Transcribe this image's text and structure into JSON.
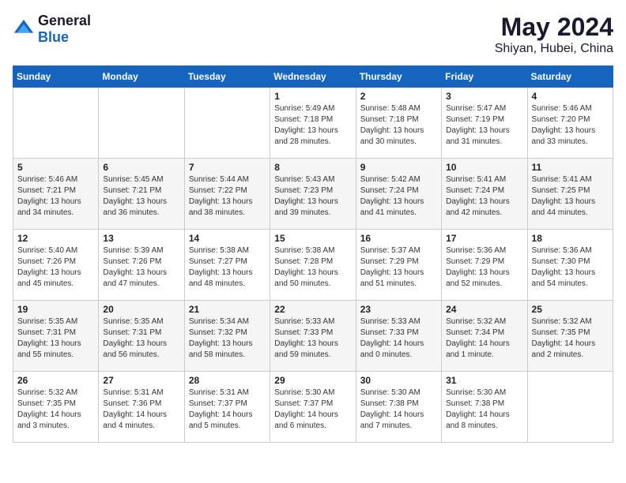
{
  "header": {
    "logo_general": "General",
    "logo_blue": "Blue",
    "month_title": "May 2024",
    "location": "Shiyan, Hubei, China"
  },
  "days_of_week": [
    "Sunday",
    "Monday",
    "Tuesday",
    "Wednesday",
    "Thursday",
    "Friday",
    "Saturday"
  ],
  "weeks": [
    [
      {
        "day": "",
        "info": ""
      },
      {
        "day": "",
        "info": ""
      },
      {
        "day": "",
        "info": ""
      },
      {
        "day": "1",
        "info": "Sunrise: 5:49 AM\nSunset: 7:18 PM\nDaylight: 13 hours\nand 28 minutes."
      },
      {
        "day": "2",
        "info": "Sunrise: 5:48 AM\nSunset: 7:18 PM\nDaylight: 13 hours\nand 30 minutes."
      },
      {
        "day": "3",
        "info": "Sunrise: 5:47 AM\nSunset: 7:19 PM\nDaylight: 13 hours\nand 31 minutes."
      },
      {
        "day": "4",
        "info": "Sunrise: 5:46 AM\nSunset: 7:20 PM\nDaylight: 13 hours\nand 33 minutes."
      }
    ],
    [
      {
        "day": "5",
        "info": "Sunrise: 5:46 AM\nSunset: 7:21 PM\nDaylight: 13 hours\nand 34 minutes."
      },
      {
        "day": "6",
        "info": "Sunrise: 5:45 AM\nSunset: 7:21 PM\nDaylight: 13 hours\nand 36 minutes."
      },
      {
        "day": "7",
        "info": "Sunrise: 5:44 AM\nSunset: 7:22 PM\nDaylight: 13 hours\nand 38 minutes."
      },
      {
        "day": "8",
        "info": "Sunrise: 5:43 AM\nSunset: 7:23 PM\nDaylight: 13 hours\nand 39 minutes."
      },
      {
        "day": "9",
        "info": "Sunrise: 5:42 AM\nSunset: 7:24 PM\nDaylight: 13 hours\nand 41 minutes."
      },
      {
        "day": "10",
        "info": "Sunrise: 5:41 AM\nSunset: 7:24 PM\nDaylight: 13 hours\nand 42 minutes."
      },
      {
        "day": "11",
        "info": "Sunrise: 5:41 AM\nSunset: 7:25 PM\nDaylight: 13 hours\nand 44 minutes."
      }
    ],
    [
      {
        "day": "12",
        "info": "Sunrise: 5:40 AM\nSunset: 7:26 PM\nDaylight: 13 hours\nand 45 minutes."
      },
      {
        "day": "13",
        "info": "Sunrise: 5:39 AM\nSunset: 7:26 PM\nDaylight: 13 hours\nand 47 minutes."
      },
      {
        "day": "14",
        "info": "Sunrise: 5:38 AM\nSunset: 7:27 PM\nDaylight: 13 hours\nand 48 minutes."
      },
      {
        "day": "15",
        "info": "Sunrise: 5:38 AM\nSunset: 7:28 PM\nDaylight: 13 hours\nand 50 minutes."
      },
      {
        "day": "16",
        "info": "Sunrise: 5:37 AM\nSunset: 7:29 PM\nDaylight: 13 hours\nand 51 minutes."
      },
      {
        "day": "17",
        "info": "Sunrise: 5:36 AM\nSunset: 7:29 PM\nDaylight: 13 hours\nand 52 minutes."
      },
      {
        "day": "18",
        "info": "Sunrise: 5:36 AM\nSunset: 7:30 PM\nDaylight: 13 hours\nand 54 minutes."
      }
    ],
    [
      {
        "day": "19",
        "info": "Sunrise: 5:35 AM\nSunset: 7:31 PM\nDaylight: 13 hours\nand 55 minutes."
      },
      {
        "day": "20",
        "info": "Sunrise: 5:35 AM\nSunset: 7:31 PM\nDaylight: 13 hours\nand 56 minutes."
      },
      {
        "day": "21",
        "info": "Sunrise: 5:34 AM\nSunset: 7:32 PM\nDaylight: 13 hours\nand 58 minutes."
      },
      {
        "day": "22",
        "info": "Sunrise: 5:33 AM\nSunset: 7:33 PM\nDaylight: 13 hours\nand 59 minutes."
      },
      {
        "day": "23",
        "info": "Sunrise: 5:33 AM\nSunset: 7:33 PM\nDaylight: 14 hours\nand 0 minutes."
      },
      {
        "day": "24",
        "info": "Sunrise: 5:32 AM\nSunset: 7:34 PM\nDaylight: 14 hours\nand 1 minute."
      },
      {
        "day": "25",
        "info": "Sunrise: 5:32 AM\nSunset: 7:35 PM\nDaylight: 14 hours\nand 2 minutes."
      }
    ],
    [
      {
        "day": "26",
        "info": "Sunrise: 5:32 AM\nSunset: 7:35 PM\nDaylight: 14 hours\nand 3 minutes."
      },
      {
        "day": "27",
        "info": "Sunrise: 5:31 AM\nSunset: 7:36 PM\nDaylight: 14 hours\nand 4 minutes."
      },
      {
        "day": "28",
        "info": "Sunrise: 5:31 AM\nSunset: 7:37 PM\nDaylight: 14 hours\nand 5 minutes."
      },
      {
        "day": "29",
        "info": "Sunrise: 5:30 AM\nSunset: 7:37 PM\nDaylight: 14 hours\nand 6 minutes."
      },
      {
        "day": "30",
        "info": "Sunrise: 5:30 AM\nSunset: 7:38 PM\nDaylight: 14 hours\nand 7 minutes."
      },
      {
        "day": "31",
        "info": "Sunrise: 5:30 AM\nSunset: 7:38 PM\nDaylight: 14 hours\nand 8 minutes."
      },
      {
        "day": "",
        "info": ""
      }
    ]
  ]
}
